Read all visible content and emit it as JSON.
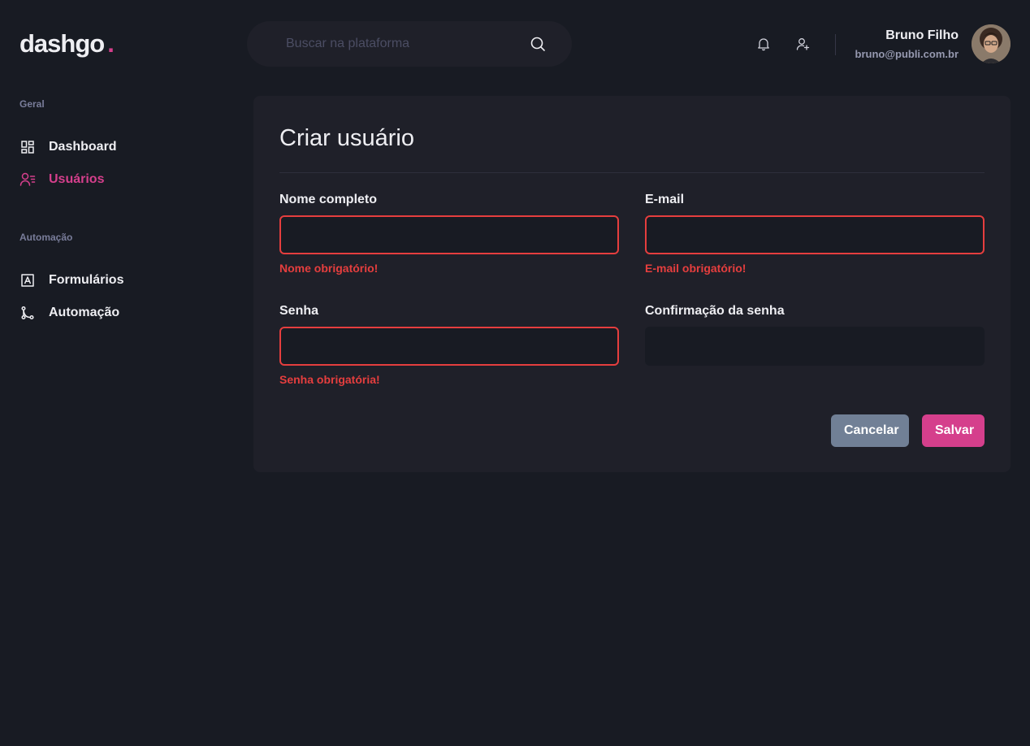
{
  "logo": {
    "text": "dashgo",
    "dot": "."
  },
  "search": {
    "placeholder": "Buscar na plataforma"
  },
  "header": {
    "icons": [
      "bell-icon",
      "user-add-icon"
    ],
    "user": {
      "name": "Bruno Filho",
      "email": "bruno@publi.com.br"
    }
  },
  "sidebar": {
    "sections": [
      {
        "title": "Geral",
        "items": [
          {
            "label": "Dashboard",
            "icon": "dashboard-icon",
            "active": false
          },
          {
            "label": "Usuários",
            "icon": "users-icon",
            "active": true
          }
        ]
      },
      {
        "title": "Automação",
        "items": [
          {
            "label": "Formulários",
            "icon": "form-icon",
            "active": false
          },
          {
            "label": "Automação",
            "icon": "git-merge-icon",
            "active": false
          }
        ]
      }
    ]
  },
  "form": {
    "title": "Criar usuário",
    "fields": {
      "name": {
        "label": "Nome completo",
        "value": "",
        "error": "Nome obrigatório!"
      },
      "email": {
        "label": "E-mail",
        "value": "",
        "error": "E-mail obrigatório!"
      },
      "password": {
        "label": "Senha",
        "value": "",
        "error": "Senha obrigatória!"
      },
      "password_confirmation": {
        "label": "Confirmação da senha",
        "value": "",
        "error": ""
      }
    },
    "buttons": {
      "cancel": "Cancelar",
      "save": "Salvar"
    }
  },
  "colors": {
    "background": "#181b23",
    "card": "#1f2029",
    "accent": "#d53f8c",
    "error": "#e53e3e",
    "cancel": "#718096"
  }
}
